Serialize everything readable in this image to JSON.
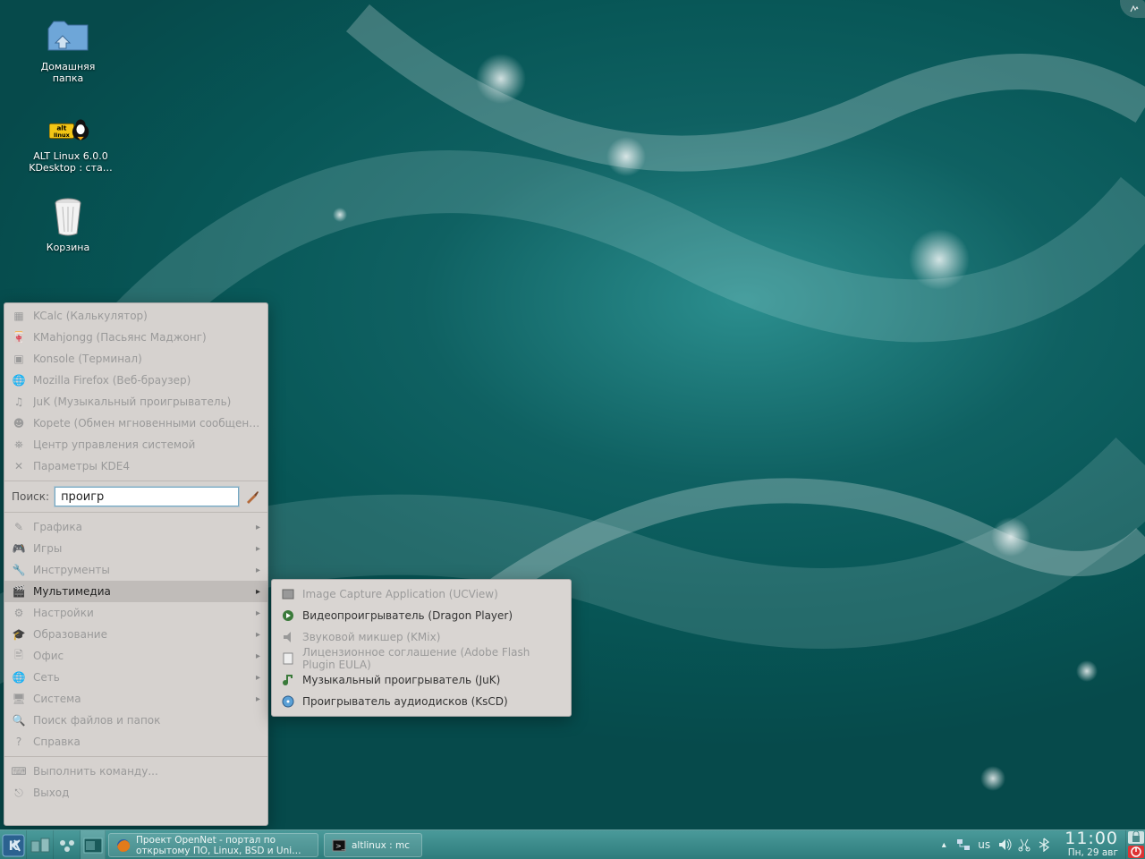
{
  "desktop_icons": {
    "home": "Домашняя\nпапка",
    "altlinux": "ALT Linux 6.0.0\nKDesktop : ста…",
    "trash": "Корзина"
  },
  "start_menu": {
    "favorites": [
      "KCalc (Калькулятор)",
      "KMahjongg (Пасьянс Маджонг)",
      "Konsole (Терминал)",
      "Mozilla Firefox (Веб-браузер)",
      "JuK (Музыкальный проигрыватель)",
      "Kopete (Обмен мгновенными сообщениями)",
      "Центр управления системой",
      "Параметры KDE4"
    ],
    "search_label": "Поиск:",
    "search_value": "проигр",
    "categories": [
      "Графика",
      "Игры",
      "Инструменты",
      "Мультимедиа",
      "Настройки",
      "Образование",
      "Офис",
      "Сеть",
      "Система",
      "Поиск файлов и папок",
      "Справка"
    ],
    "active_category_index": 3,
    "actions": [
      "Выполнить команду...",
      "Выход"
    ]
  },
  "submenu": [
    "Image Capture Application (UCView)",
    "Видеопроигрыватель (Dragon Player)",
    "Звуковой микшер (KMix)",
    "Лицензионное соглашение (Adobe Flash Plugin EULA)",
    "Музыкальный проигрыватель (JuK)",
    "Проигрыватель аудиодисков (KsCD)"
  ],
  "submenu_accent": [
    false,
    true,
    false,
    false,
    true,
    true
  ],
  "panel": {
    "task1_line1": "Проект OpenNet - портал по",
    "task1_line2": "открытому ПО, Linux, BSD и Uni…",
    "task2": "altlinux : mc",
    "kb_layout": "us",
    "time": "11:00",
    "date": "Пн, 29 авг"
  }
}
